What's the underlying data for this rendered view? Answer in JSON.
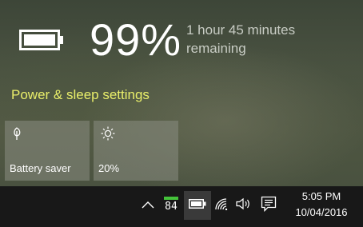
{
  "battery": {
    "percent_text": "99%",
    "level": 0.99,
    "remaining_line1": "1 hour 45 minutes",
    "remaining_line2": "remaining"
  },
  "links": {
    "power_sleep": "Power & sleep settings"
  },
  "tiles": [
    {
      "label": "Battery saver",
      "icon": "leaf-icon"
    },
    {
      "label": "20%",
      "icon": "brightness-icon"
    }
  ],
  "taskbar": {
    "meter_value": "84",
    "time": "5:05 PM",
    "date": "10/04/2016",
    "icons": [
      "chevron-up-icon",
      "meter-icon",
      "battery-icon",
      "wifi-icon",
      "volume-icon",
      "notification-icon"
    ]
  },
  "colors": {
    "link": "#e9ee6a",
    "meter_bar": "#44c33a",
    "taskbar": "#181818"
  }
}
